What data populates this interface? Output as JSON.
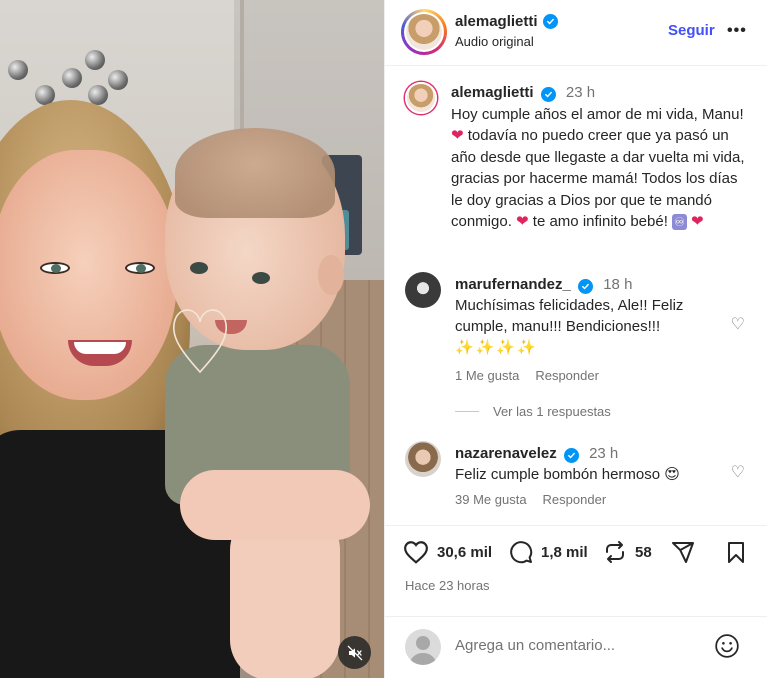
{
  "post": {
    "username": "alemaglietti",
    "audio": "Audio original",
    "follow_label": "Seguir",
    "more_label": "•••"
  },
  "caption": {
    "username": "alemaglietti",
    "time": "23 h",
    "text_1": "Hoy cumple años el amor de mi vida, Manu!",
    "heart_1": "❤",
    "text_2": " todavía no puedo creer que ya pasó un año desde que llegaste a dar vuelta mi vida, gracias por hacerme mamá! Todos los días le doy gracias a Dios por que te mandó conmigo. ",
    "heart_2": "❤",
    "text_3": " te amo infinito bebé! ",
    "infinity": "♾",
    "heart_3": "❤"
  },
  "comments": [
    {
      "username": "marufernandez_",
      "time": "18 h",
      "text": "Muchísimas felicidades, Ale!! Feliz cumple, manu!!! Bendiciones!!!",
      "emoji": "✨✨✨✨",
      "likes": "1 Me gusta",
      "reply": "Responder"
    },
    {
      "username": "nazarenavelez",
      "time": "23 h",
      "text": "Feliz cumple bombón hermoso ",
      "emoji": "😍",
      "likes": "39 Me gusta",
      "reply": "Responder"
    }
  ],
  "view_replies": "Ver las 1 respuestas",
  "actions": {
    "likes": "30,6 mil",
    "comments": "1,8 mil",
    "reposts": "58"
  },
  "posted_ago": "Hace 23 horas",
  "add_comment": {
    "placeholder": "Agrega un comentario..."
  },
  "colors": {
    "accent": "#4150f7",
    "verified": "#0095f6",
    "muted": "#737373",
    "heart": "#e0245e"
  }
}
